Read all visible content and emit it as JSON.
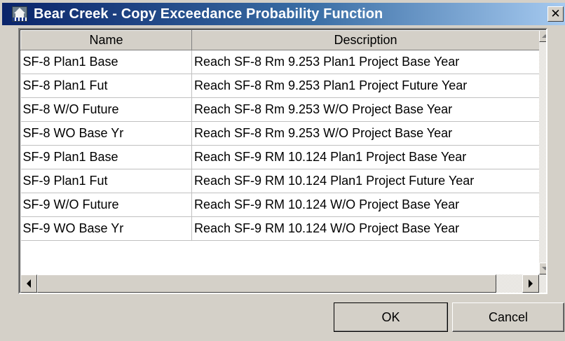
{
  "window": {
    "title": "Bear Creek - Copy Exceedance Probability Function",
    "close_glyph": "✕",
    "icon": "hec-fda-app-icon"
  },
  "table": {
    "columns": [
      "Name",
      "Description"
    ],
    "rows": [
      {
        "name": "SF-8 Plan1 Base",
        "description": "Reach SF-8 Rm 9.253 Plan1 Project Base Year"
      },
      {
        "name": "SF-8 Plan1 Fut",
        "description": "Reach SF-8 Rm 9.253 Plan1 Project Future Year"
      },
      {
        "name": "SF-8 W/O Future",
        "description": "Reach SF-8 Rm 9.253 W/O Project Base Year"
      },
      {
        "name": "SF-8 WO Base Yr",
        "description": "Reach SF-8 Rm 9.253 W/O Project Base Year"
      },
      {
        "name": "SF-9 Plan1 Base",
        "description": "Reach SF-9 RM  10.124 Plan1 Project Base Year"
      },
      {
        "name": "SF-9 Plan1 Fut",
        "description": "Reach SF-9 RM  10.124 Plan1 Project Future Year"
      },
      {
        "name": "SF-9 W/O Future",
        "description": "Reach SF-9 RM  10.124 W/O Project Base Year"
      },
      {
        "name": "SF-9 WO Base Yr",
        "description": "Reach SF-9 RM  10.124 W/O Project Base Year"
      }
    ]
  },
  "buttons": {
    "ok": "OK",
    "cancel": "Cancel"
  },
  "colors": {
    "titlebar_start": "#0a246a",
    "titlebar_end": "#a6caf0",
    "face": "#d4d0c8"
  }
}
